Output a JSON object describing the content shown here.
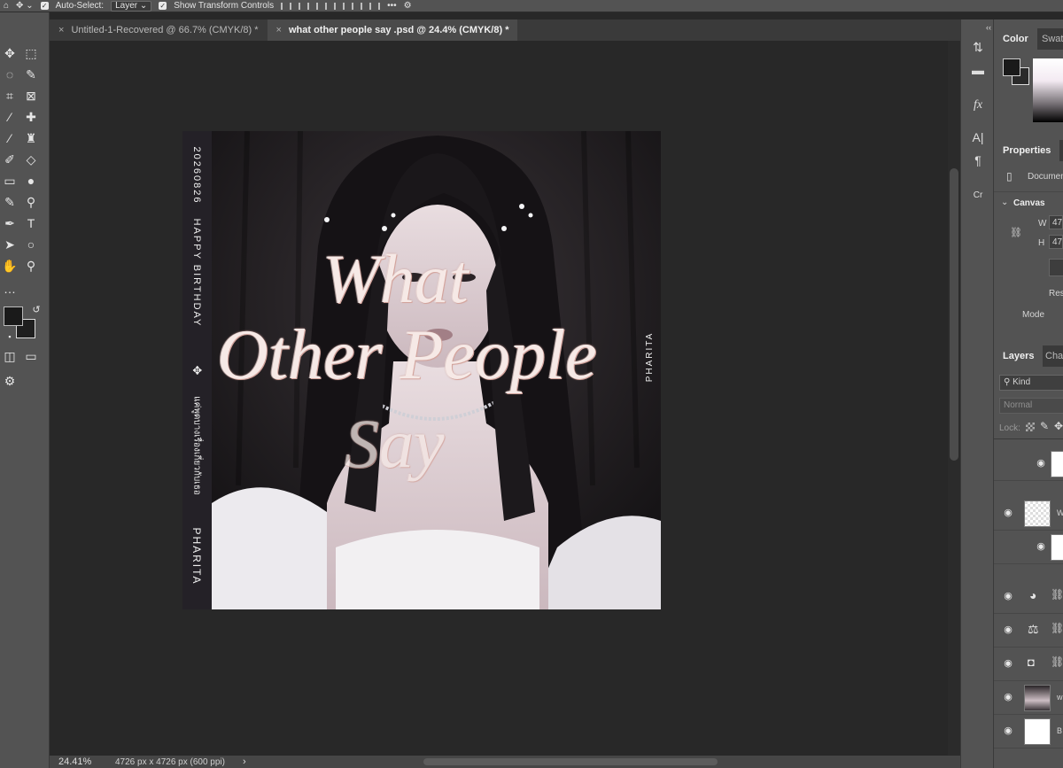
{
  "options_bar": {
    "auto_select_label": "Auto-Select:",
    "auto_select_value": "Layer",
    "show_transform_label": "Show Transform Controls",
    "more": "•••"
  },
  "tabs": [
    {
      "label": "Untitled-1-Recovered @ 66.7% (CMYK/8) *",
      "close": "×"
    },
    {
      "label": "what other people say .psd @ 24.4% (CMYK/8) *",
      "close": "×"
    }
  ],
  "artwork": {
    "spine_date": "20260826",
    "spine_birthday": "HAPPY BIRTHDAY",
    "spine_thai": "แค่พูดบางเรื่องเกี่ยวกับเธอ",
    "spine_name": "PHARITA",
    "cover_name": "PHARITA",
    "title_line1": "What",
    "title_line2": "Other People",
    "title_line3": "Say"
  },
  "status_bar": {
    "zoom": "24.41%",
    "doc_info": "4726 px x 4726 px (600 ppi)",
    "arrow": "›"
  },
  "panels": {
    "color_tab": "Color",
    "swatches_tab": "Swatc",
    "properties_tab": "Properties",
    "document_label": "Documen",
    "canvas_section": "Canvas",
    "w_label": "W",
    "w_value": "47",
    "h_label": "H",
    "h_value": "47",
    "resample_label": "Res",
    "mode_label": "Mode",
    "layers_tab": "Layers",
    "channels_tab": "Cha",
    "kind_filter": "Kind",
    "blend_mode": "Normal",
    "lock_label": "Lock:",
    "layer_names": [
      "W",
      "w",
      "B"
    ]
  },
  "colors": {
    "foreground": "#1a1a1a",
    "background": "#ffffff",
    "panel_bg": "#535353",
    "canvas_bg": "#282828"
  }
}
